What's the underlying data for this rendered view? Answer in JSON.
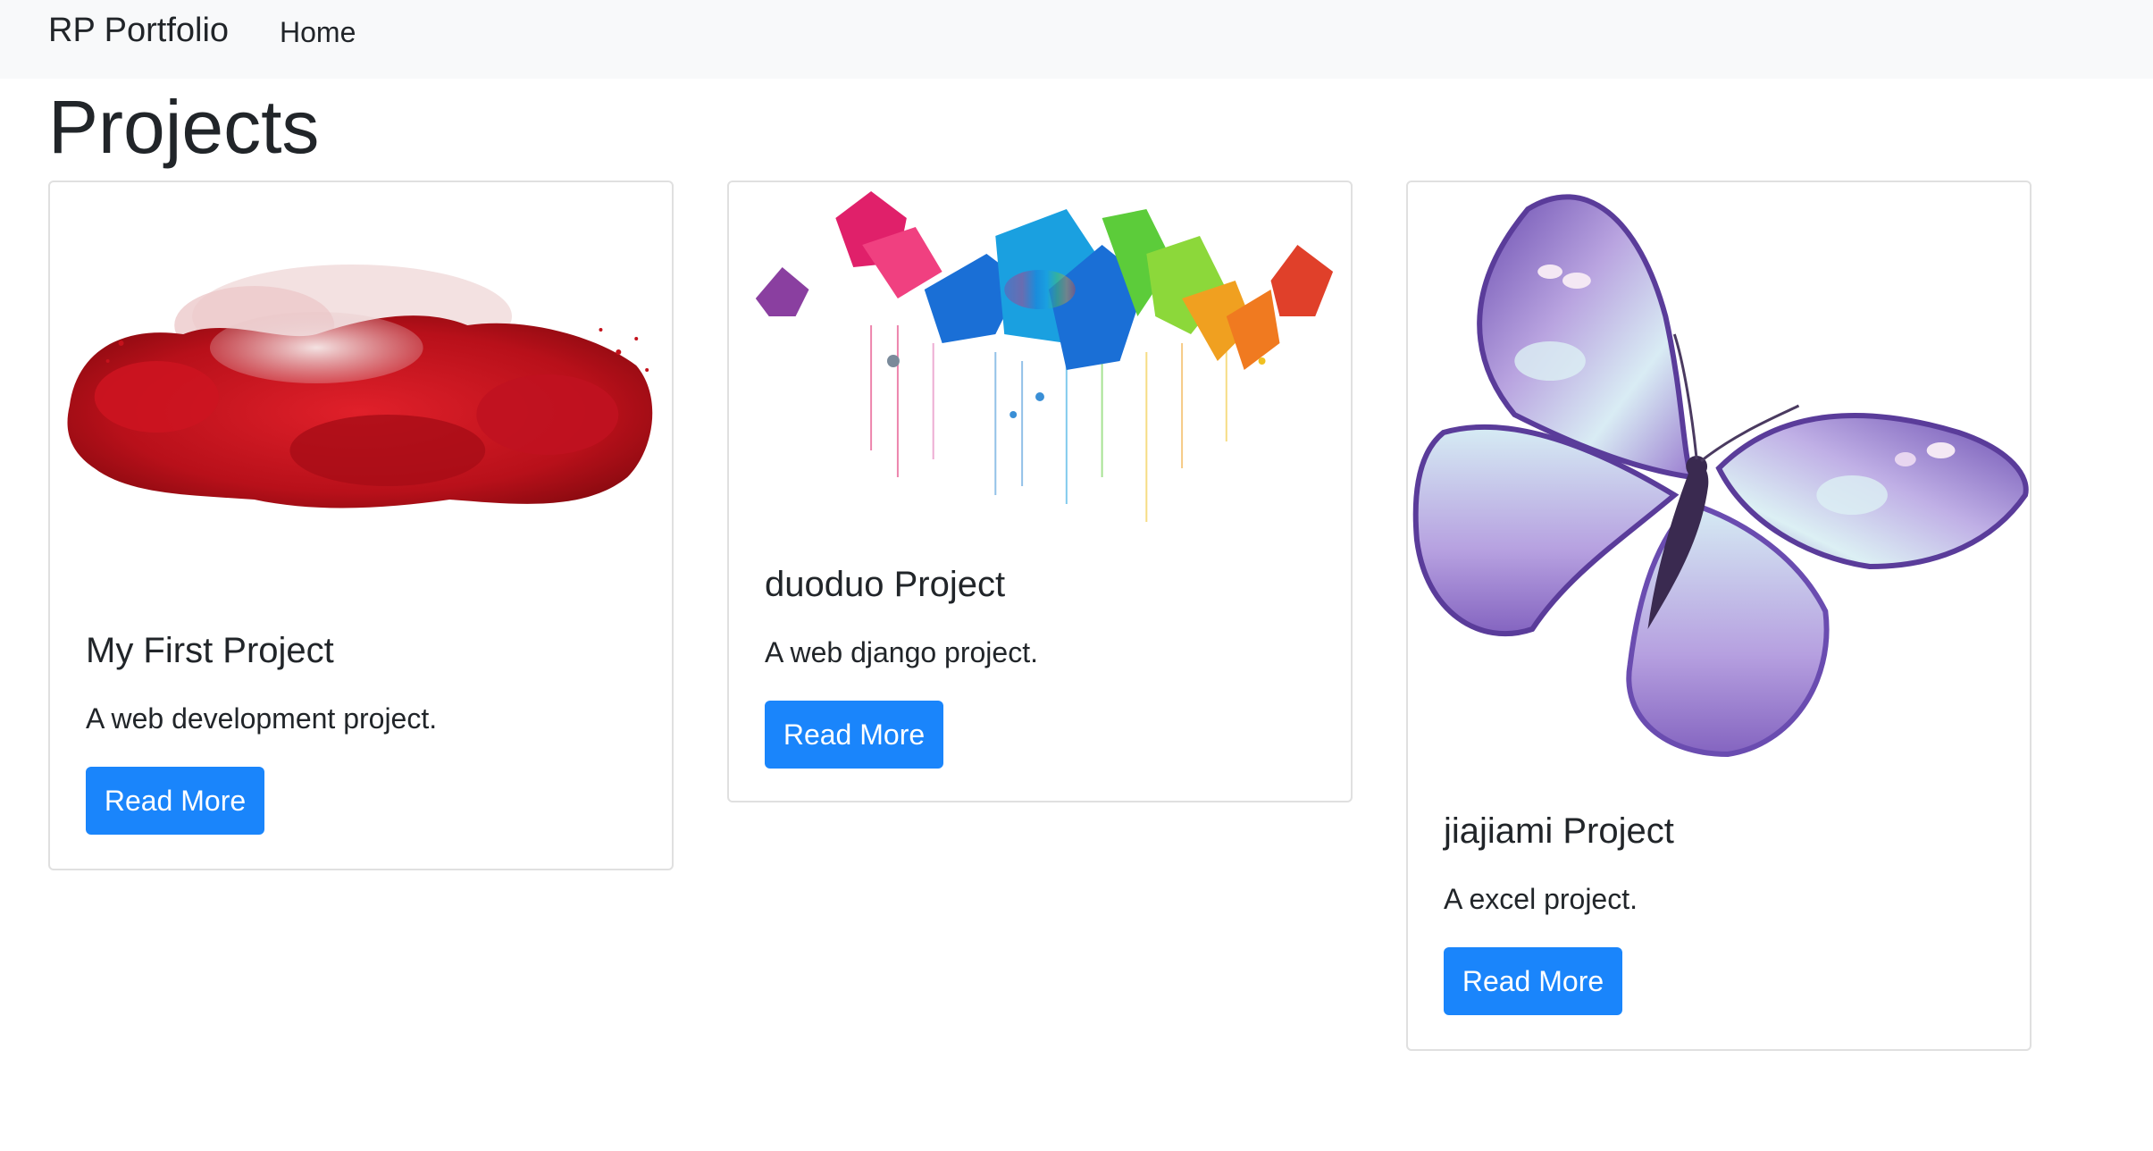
{
  "navbar": {
    "brand": "RP Portfolio",
    "links": [
      {
        "label": "Home"
      }
    ]
  },
  "page": {
    "title": "Projects"
  },
  "projects": [
    {
      "title": "My First Project",
      "description": "A web development project.",
      "button_label": "Read More",
      "image_icon": "red-smoke-image"
    },
    {
      "title": "duoduo Project",
      "description": "A web django project.",
      "button_label": "Read More",
      "image_icon": "colorful-flowers-image"
    },
    {
      "title": "jiajiami Project",
      "description": "A excel project.",
      "button_label": "Read More",
      "image_icon": "purple-butterfly-image"
    }
  ],
  "colors": {
    "navbar_bg": "#f8f9fa",
    "button_bg": "#1a85fb",
    "card_border": "#e0e0e0",
    "text": "#212529"
  }
}
